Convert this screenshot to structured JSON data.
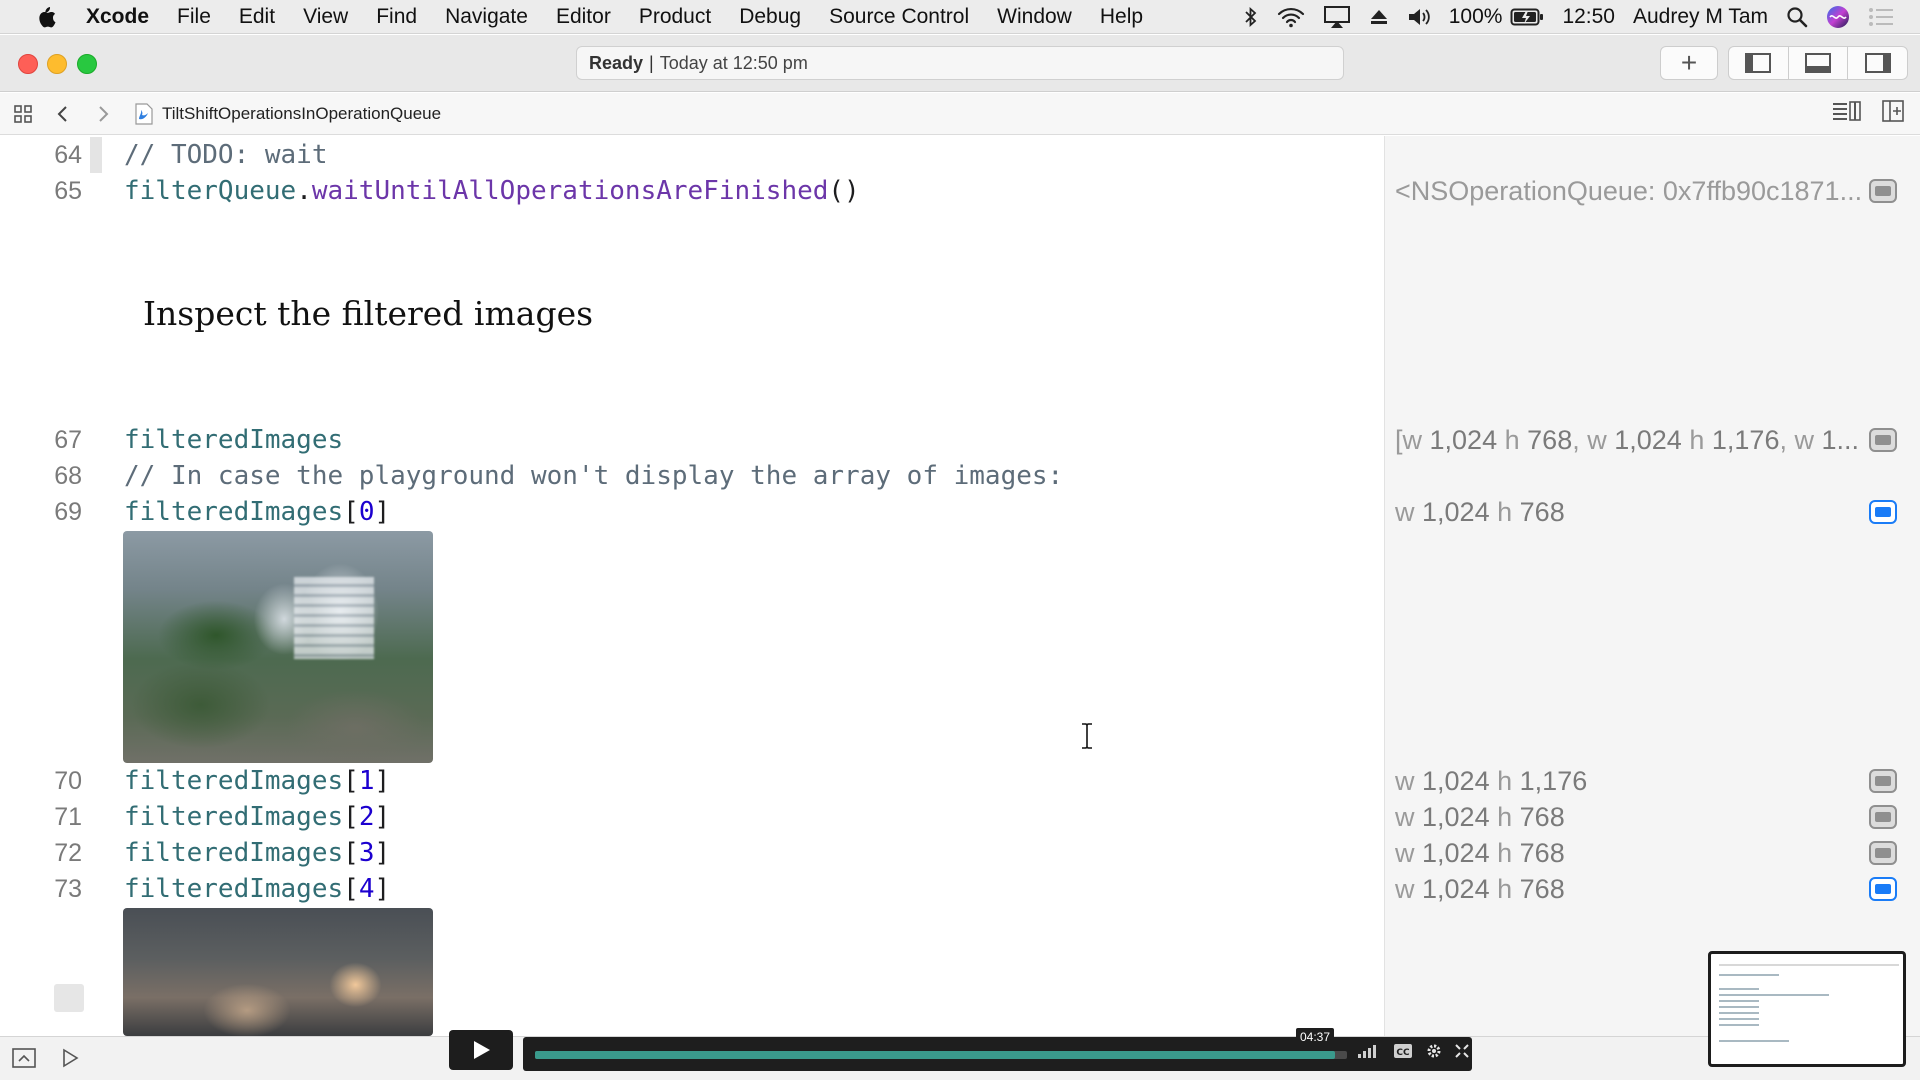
{
  "menubar": {
    "app": "Xcode",
    "items": [
      "File",
      "Edit",
      "View",
      "Find",
      "Navigate",
      "Editor",
      "Product",
      "Debug",
      "Source Control",
      "Window",
      "Help"
    ],
    "battery": "100%",
    "time": "12:50",
    "user": "Audrey M Tam",
    "icons": [
      "apple-icon",
      "bluetooth-icon",
      "wifi-icon",
      "airplay-icon",
      "eject-icon",
      "volume-icon",
      "battery-icon",
      "spotlight-icon",
      "siri-icon",
      "notification-center-icon"
    ]
  },
  "toolbar": {
    "status_strong": "Ready",
    "status_sep": "|",
    "status_time": "Today at 12:50 pm",
    "add_label": "+"
  },
  "jumpbar": {
    "file": "TiltShiftOperationsInOperationQueue"
  },
  "editor": {
    "lines": [
      {
        "num": "64",
        "comment": "// TODO: wait"
      },
      {
        "num": "65",
        "var": "filterQueue",
        "dot": ".",
        "method": "waitUntilAllOperationsAreFinished",
        "punct": "()"
      },
      {
        "num": "67",
        "var": "filteredImages"
      },
      {
        "num": "68",
        "comment": "// In case the playground won't display the array of images:"
      },
      {
        "num": "69",
        "var": "filteredImages",
        "open": "[",
        "index": "0",
        "close": "]"
      },
      {
        "num": "70",
        "var": "filteredImages",
        "open": "[",
        "index": "1",
        "close": "]"
      },
      {
        "num": "71",
        "var": "filteredImages",
        "open": "[",
        "index": "2",
        "close": "]"
      },
      {
        "num": "72",
        "var": "filteredImages",
        "open": "[",
        "index": "3",
        "close": "]"
      },
      {
        "num": "73",
        "var": "filteredImages",
        "open": "[",
        "index": "4",
        "close": "]"
      }
    ],
    "markup_heading": "Inspect the filtered images"
  },
  "results": {
    "r65": "<NSOperationQueue: 0x7ffb90c1871...",
    "r67": {
      "b1": "[w",
      "n1": "1,024",
      "h1": "h",
      "n2": "768",
      "c1": ", w",
      "n3": "1,024",
      "h2": "h",
      "n4": "1,176",
      "c2": ", w",
      "n5": "1..."
    },
    "r69": {
      "w": "w",
      "wv": "1,024",
      "h": "h",
      "hv": "768"
    },
    "r70": {
      "w": "w",
      "wv": "1,024",
      "h": "h",
      "hv": "1,176"
    },
    "r71": {
      "w": "w",
      "wv": "1,024",
      "h": "h",
      "hv": "768"
    },
    "r72": {
      "w": "w",
      "wv": "1,024",
      "h": "h",
      "hv": "768"
    },
    "r73": {
      "w": "w",
      "wv": "1,024",
      "h": "h",
      "hv": "768"
    }
  },
  "player": {
    "time": "04:37",
    "progress": 0.985
  },
  "colors": {
    "comment": "#5d6c79",
    "variable": "#326d74",
    "method": "#6c36a9",
    "number": "#1c00cf",
    "accent": "#1a7cf7"
  }
}
